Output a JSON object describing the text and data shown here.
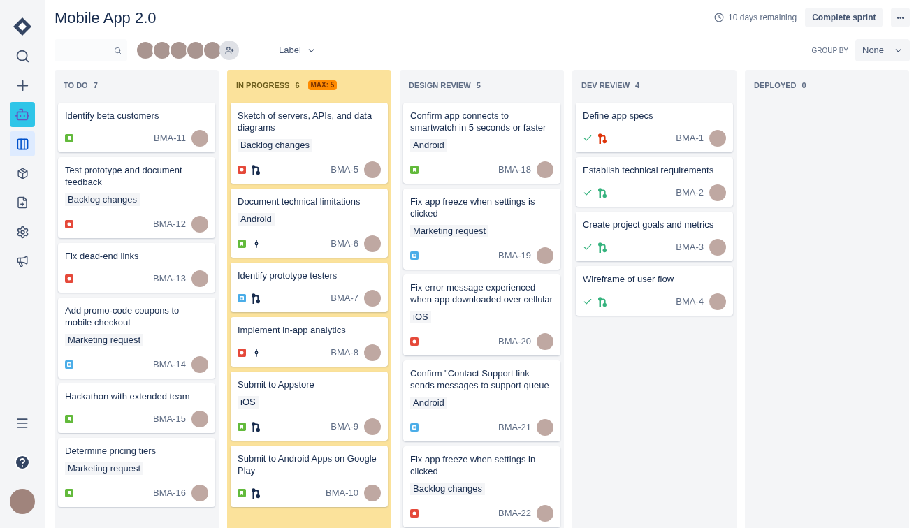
{
  "sidebar": {
    "top": [
      {
        "kind": "logo",
        "selected": false
      },
      {
        "kind": "search",
        "selected": false
      },
      {
        "kind": "create",
        "selected": false
      },
      {
        "kind": "project",
        "selected": false
      },
      {
        "kind": "board",
        "selected": true
      },
      {
        "kind": "releases",
        "selected": false
      },
      {
        "kind": "pages",
        "selected": false
      },
      {
        "kind": "settings",
        "selected": false
      },
      {
        "kind": "announce",
        "selected": false
      }
    ],
    "bottom": [
      {
        "kind": "menu",
        "selected": false
      },
      {
        "kind": "help",
        "selected": false
      },
      {
        "kind": "avatar",
        "selected": false
      }
    ]
  },
  "title": "Mobile App 2.0",
  "sprint": {
    "remaining": "10 days remaining",
    "button": "Complete sprint",
    "more": "•••"
  },
  "filters": {
    "label_filter": "Label",
    "group_by_label": "GROUP BY",
    "group_by_value": "None"
  },
  "columns": [
    {
      "name": "TO DO",
      "count": "7",
      "over_limit": false,
      "cards": [
        {
          "title": "Identify beta customers",
          "kind": "story",
          "key": "BMA-11"
        },
        {
          "title": "Test prototype and document feedback",
          "label": "Backlog changes",
          "kind": "bug",
          "key": "BMA-12"
        },
        {
          "title": "Fix dead-end links",
          "kind": "bug",
          "key": "BMA-13"
        },
        {
          "title": "Add promo-code coupons to mobile checkout",
          "label": "Marketing request",
          "kind": "task",
          "key": "BMA-14"
        },
        {
          "title": "Hackathon with extended team",
          "kind": "story",
          "key": "BMA-15"
        },
        {
          "title": "Determine pricing tiers",
          "label": "Marketing request",
          "kind": "story",
          "key": "BMA-16"
        }
      ]
    },
    {
      "name": "IN PROGRESS",
      "count": "6",
      "limit": "MAX: 5",
      "over_limit": true,
      "cards": [
        {
          "title": "Sketch of servers, APIs, and data diagrams",
          "label": "Backlog changes",
          "kind": "bug",
          "dev": {
            "kind": "pr",
            "color": "#172b4d"
          },
          "key": "BMA-5"
        },
        {
          "title": "Document technical limitations",
          "label": "Android",
          "kind": "story",
          "dev": {
            "kind": "commit",
            "color": "#172b4d"
          },
          "key": "BMA-6"
        },
        {
          "title": "Identify prototype testers",
          "kind": "task",
          "dev": {
            "kind": "pr",
            "color": "#172b4d"
          },
          "key": "BMA-7"
        },
        {
          "title": "Implement in-app analytics",
          "kind": "bug",
          "dev": {
            "kind": "commit",
            "color": "#172b4d"
          },
          "key": "BMA-8"
        },
        {
          "title": "Submit to Appstore",
          "label": "iOS",
          "kind": "story",
          "dev": {
            "kind": "pr",
            "color": "#172b4d"
          },
          "key": "BMA-9"
        },
        {
          "title": "Submit to Android Apps on Google Play",
          "kind": "story",
          "dev": {
            "kind": "pr",
            "color": "#172b4d"
          },
          "key": "BMA-10"
        }
      ]
    },
    {
      "name": "DESIGN REVIEW",
      "count": "5",
      "over_limit": false,
      "cards": [
        {
          "title": "Confirm app connects to smartwatch in 5 seconds or faster",
          "label": "Android",
          "kind": "story",
          "key": "BMA-18"
        },
        {
          "title": "Fix app freeze when settings is clicked",
          "label": "Marketing request",
          "kind": "task",
          "key": "BMA-19"
        },
        {
          "title": "Fix error message experienced when app downloaded over cellular",
          "label": "iOS",
          "kind": "bug",
          "key": "BMA-20"
        },
        {
          "title": "Confirm \"Contact Support link sends messages to support queue",
          "label": "Android",
          "kind": "task",
          "key": "BMA-21"
        },
        {
          "title": "Fix app freeze when settings in clicked",
          "label": "Backlog changes",
          "kind": "bug",
          "key": "BMA-22"
        }
      ]
    },
    {
      "name": "DEV REVIEW",
      "count": "4",
      "over_limit": false,
      "cards": [
        {
          "title": "Define app specs",
          "done": true,
          "dev": {
            "kind": "pr",
            "color": "#de350b"
          },
          "key": "BMA-1"
        },
        {
          "title": "Establish technical requirements",
          "done": true,
          "dev": {
            "kind": "pr",
            "color": "#36b37e"
          },
          "key": "BMA-2"
        },
        {
          "title": "Create project goals and metrics",
          "done": true,
          "dev": {
            "kind": "pr",
            "color": "#36b37e"
          },
          "key": "BMA-3"
        },
        {
          "title": "Wireframe of user flow",
          "done": true,
          "dev": {
            "kind": "pr",
            "color": "#36b37e"
          },
          "key": "BMA-4"
        }
      ]
    },
    {
      "name": "DEPLOYED",
      "count": "0",
      "over_limit": false
    }
  ]
}
